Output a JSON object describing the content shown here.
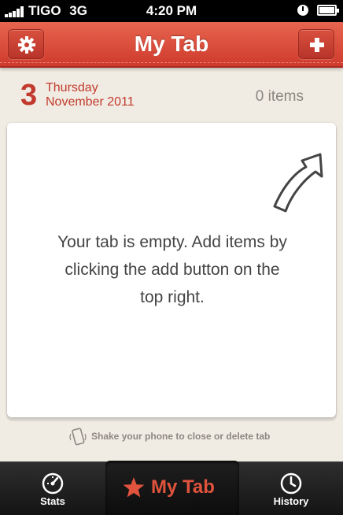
{
  "status_bar": {
    "carrier": "TIGO",
    "network": "3G",
    "time": "4:20 PM"
  },
  "nav": {
    "title": "My Tab",
    "left_icon": "gear-icon",
    "right_icon": "plus-icon"
  },
  "date": {
    "day_number": "3",
    "weekday": "Thursday",
    "month_year": "November 2011"
  },
  "item_count": "0 items",
  "empty_message": "Your tab is empty. Add items by clicking the add button on the top right.",
  "hint": "Shake your phone to close or delete tab",
  "tabs": {
    "stats": {
      "label": "Stats",
      "icon": "speedometer-icon"
    },
    "my_tab": {
      "label": "My Tab",
      "icon": "star-icon"
    },
    "history": {
      "label": "History",
      "icon": "clock-icon"
    }
  },
  "colors": {
    "accent_red": "#d94a37",
    "date_red": "#c23a2d",
    "tab_bar_dark": "#1a1a1a",
    "background": "#f1ece3"
  }
}
